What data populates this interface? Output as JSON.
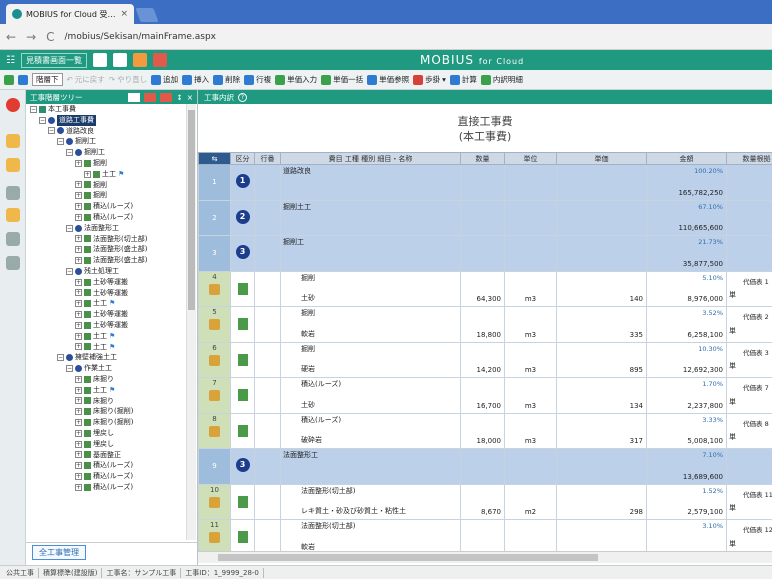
{
  "browser": {
    "tab_title": "MOBIUS for Cloud 受…",
    "tab_close": "×",
    "back": "←",
    "forward": "→",
    "reload": "C",
    "url": "/mobius/Sekisan/mainFrame.aspx"
  },
  "app": {
    "menu_label": "見積書画面一覧",
    "logo": "MOBIUS",
    "logo_suffix": "for Cloud"
  },
  "toolbar": {
    "items": [
      {
        "label": "階層下",
        "state": "dropdown"
      },
      {
        "label": "元に戻す",
        "state": "disabled"
      },
      {
        "label": "やり直し",
        "state": "disabled"
      },
      {
        "label": "追加",
        "icon": "add-icon"
      },
      {
        "label": "挿入",
        "icon": "insert-icon"
      },
      {
        "label": "削除",
        "icon": "delete-icon"
      },
      {
        "label": "行複",
        "icon": "copy-row-icon"
      },
      {
        "label": "単価入力",
        "icon": "price-icon"
      },
      {
        "label": "単価一括",
        "icon": "price-bulk-icon"
      },
      {
        "label": "単価参照",
        "icon": "price-ref-icon"
      },
      {
        "label": "歩掛",
        "icon": "rate-icon"
      },
      {
        "label": "計算",
        "icon": "calc-icon"
      },
      {
        "label": "内訳明細",
        "icon": "detail-icon"
      }
    ]
  },
  "tree": {
    "title": "工事階層ツリー",
    "footer_button": "全工事管理",
    "nodes": [
      {
        "label": "本工事費",
        "level": 0,
        "icon": "top",
        "expander": "−"
      },
      {
        "label": "道路工事費",
        "level": 1,
        "icon": "num",
        "expander": "−",
        "selected": true
      },
      {
        "label": "道路改良",
        "level": 2,
        "icon": "num",
        "expander": "−"
      },
      {
        "label": "掘削工",
        "level": 3,
        "icon": "num",
        "expander": "−"
      },
      {
        "label": "掘削工",
        "level": 4,
        "icon": "num",
        "expander": "−"
      },
      {
        "label": "掘削",
        "level": 5,
        "icon": "doc",
        "expander": "+"
      },
      {
        "label": "土工",
        "level": 6,
        "icon": "doc",
        "expander": "+",
        "flag": true
      },
      {
        "label": "掘削",
        "level": 5,
        "icon": "doc",
        "expander": "+"
      },
      {
        "label": "掘削",
        "level": 5,
        "icon": "doc",
        "expander": "+"
      },
      {
        "label": "積込(ルーズ)",
        "level": 5,
        "icon": "doc",
        "expander": "+"
      },
      {
        "label": "積込(ルーズ)",
        "level": 5,
        "icon": "doc",
        "expander": "+"
      },
      {
        "label": "法面整形工",
        "level": 4,
        "icon": "num",
        "expander": "−"
      },
      {
        "label": "法面整形(切土部)",
        "level": 5,
        "icon": "doc",
        "expander": "+"
      },
      {
        "label": "法面整形(盛土部)",
        "level": 5,
        "icon": "doc",
        "expander": "+"
      },
      {
        "label": "法面整形(盛土部)",
        "level": 5,
        "icon": "doc",
        "expander": "+"
      },
      {
        "label": "残土処理工",
        "level": 4,
        "icon": "num",
        "expander": "−"
      },
      {
        "label": "土砂等運搬",
        "level": 5,
        "icon": "doc",
        "expander": "+"
      },
      {
        "label": "土砂等運搬",
        "level": 5,
        "icon": "doc",
        "expander": "+"
      },
      {
        "label": "土工",
        "level": 5,
        "icon": "doc",
        "expander": "+",
        "flag": true
      },
      {
        "label": "土砂等運搬",
        "level": 5,
        "icon": "doc",
        "expander": "+"
      },
      {
        "label": "土砂等運搬",
        "level": 5,
        "icon": "doc",
        "expander": "+"
      },
      {
        "label": "土工",
        "level": 5,
        "icon": "doc",
        "expander": "+",
        "flag": true
      },
      {
        "label": "土工",
        "level": 5,
        "icon": "doc",
        "expander": "+",
        "flag": true
      },
      {
        "label": "擁壁補強土工",
        "level": 3,
        "icon": "num",
        "expander": "−"
      },
      {
        "label": "作業土工",
        "level": 4,
        "icon": "num",
        "expander": "−"
      },
      {
        "label": "床掘り",
        "level": 5,
        "icon": "doc",
        "expander": "+"
      },
      {
        "label": "土工",
        "level": 5,
        "icon": "doc",
        "expander": "+",
        "flag": true
      },
      {
        "label": "床掘り",
        "level": 5,
        "icon": "doc",
        "expander": "+"
      },
      {
        "label": "床掘り(掘削)",
        "level": 5,
        "icon": "doc",
        "expander": "+"
      },
      {
        "label": "床掘り(掘削)",
        "level": 5,
        "icon": "doc",
        "expander": "+"
      },
      {
        "label": "埋戻し",
        "level": 5,
        "icon": "doc",
        "expander": "+"
      },
      {
        "label": "埋戻し",
        "level": 5,
        "icon": "doc",
        "expander": "+"
      },
      {
        "label": "基面整正",
        "level": 5,
        "icon": "doc",
        "expander": "+"
      },
      {
        "label": "積込(ルーズ)",
        "level": 5,
        "icon": "doc",
        "expander": "+"
      },
      {
        "label": "積込(ルーズ)",
        "level": 5,
        "icon": "doc",
        "expander": "+"
      },
      {
        "label": "積込(ルーズ)",
        "level": 5,
        "icon": "doc",
        "expander": "+"
      }
    ]
  },
  "main": {
    "panel_title": "工事内訳",
    "help": "?",
    "doc_title_1": "直接工事費",
    "doc_title_2": "(本工事費)",
    "columns": [
      "区分",
      "行番",
      "費目 工種 種別 細目・名称",
      "数量",
      "単位",
      "単価",
      "金額",
      "数量根拠"
    ],
    "rows": [
      {
        "type": "summary",
        "no": "1",
        "badge": "1",
        "name1": "道路改良",
        "name2": "",
        "qty": "",
        "unit": "",
        "price": "",
        "pct": "100.20%",
        "amount": "165,782,250",
        "kind": "",
        "remark": ""
      },
      {
        "type": "summary",
        "no": "2",
        "badge": "2",
        "name1": "掘削土工",
        "name2": "",
        "qty": "",
        "unit": "",
        "price": "",
        "pct": "67.10%",
        "amount": "110,665,600",
        "kind": "",
        "remark": ""
      },
      {
        "type": "summary",
        "no": "3",
        "badge": "3",
        "name1": "掘削工",
        "name2": "",
        "qty": "",
        "unit": "",
        "price": "",
        "pct": "21.73%",
        "amount": "35,877,500",
        "kind": "",
        "remark": ""
      },
      {
        "type": "detail",
        "no": "4",
        "name1": "掘削",
        "name2": "土砂",
        "qty": "64,300",
        "unit": "m3",
        "price": "140",
        "pct": "5.10%",
        "amount": "8,976,000",
        "kind": "単",
        "remark": "代価表 1"
      },
      {
        "type": "detail",
        "no": "5",
        "name1": "掘削",
        "name2": "軟岩",
        "qty": "18,800",
        "unit": "m3",
        "price": "335",
        "pct": "3.52%",
        "amount": "6,258,100",
        "kind": "単",
        "remark": "代価表 2"
      },
      {
        "type": "detail",
        "no": "6",
        "name1": "掘削",
        "name2": "硬岩",
        "qty": "14,200",
        "unit": "m3",
        "price": "895",
        "pct": "10.30%",
        "amount": "12,692,300",
        "kind": "単",
        "remark": "代価表 3"
      },
      {
        "type": "detail",
        "no": "7",
        "name1": "積込(ルーズ)",
        "name2": "土砂",
        "qty": "16,700",
        "unit": "m3",
        "price": "134",
        "pct": "1.70%",
        "amount": "2,237,800",
        "kind": "単",
        "remark": "代価表 7"
      },
      {
        "type": "detail",
        "no": "8",
        "name1": "積込(ルーズ)",
        "name2": "破砕岩",
        "qty": "18,000",
        "unit": "m3",
        "price": "317",
        "pct": "3.33%",
        "amount": "5,008,100",
        "kind": "単",
        "remark": "代価表 8"
      },
      {
        "type": "summary",
        "no": "9",
        "badge": "3",
        "name1": "法面整形工",
        "name2": "",
        "qty": "",
        "unit": "",
        "price": "",
        "pct": "7.10%",
        "amount": "13,689,600",
        "kind": "",
        "remark": ""
      },
      {
        "type": "detail",
        "no": "10",
        "name1": "法面整形(切土部)",
        "name2": "レキ質土・砂及び砂質土・粘性土",
        "qty": "8,670",
        "unit": "m2",
        "price": "298",
        "pct": "1.52%",
        "amount": "2,579,100",
        "kind": "単",
        "remark": "代価表 11"
      },
      {
        "type": "detail",
        "no": "11",
        "name1": "法面整形(切土部)",
        "name2": "軟岩",
        "qty": "",
        "unit": "",
        "price": "",
        "pct": "3.10%",
        "amount": "",
        "kind": "単",
        "remark": "代価表 12"
      }
    ]
  },
  "status": {
    "items": [
      "公共工事",
      "積算標準(建設版)",
      "工事名：サンプル工事",
      "工事ID：1_9999_28-0"
    ]
  }
}
